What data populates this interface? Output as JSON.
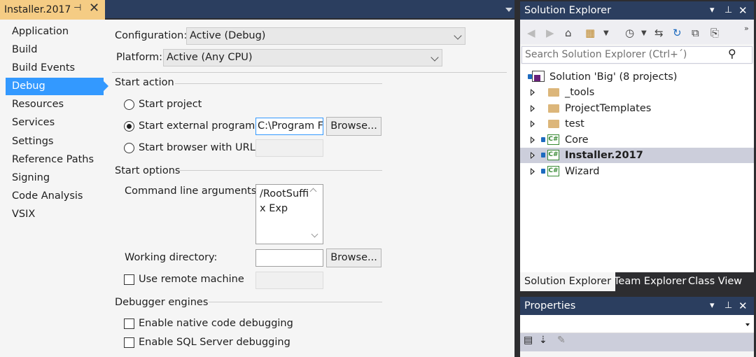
{
  "doc_tab": {
    "title": "Installer.2017",
    "pin_icon": "pin-icon",
    "close_icon": "close-icon"
  },
  "nav": {
    "items": [
      "Application",
      "Build",
      "Build Events",
      "Debug",
      "Resources",
      "Services",
      "Settings",
      "Reference Paths",
      "Signing",
      "Code Analysis",
      "VSIX"
    ],
    "active": "Debug"
  },
  "config": {
    "configuration_label": "Configuration:",
    "configuration_value": "Active (Debug)",
    "platform_label": "Platform:",
    "platform_value": "Active (Any CPU)"
  },
  "start_action": {
    "header": "Start action",
    "start_project": "Start project",
    "start_external": "Start external program:",
    "external_path": "C:\\Program Fil",
    "start_browser": "Start browser with URL:",
    "browse_label": "Browse...",
    "selected": "start_external"
  },
  "start_options": {
    "header": "Start options",
    "cmd_label": "Command line arguments:",
    "cmd_value": "/RootSuffix Exp",
    "working_dir_label": "Working directory:",
    "working_dir_value": "",
    "browse_label": "Browse...",
    "remote_label": "Use remote machine"
  },
  "debugger_engines": {
    "header": "Debugger engines",
    "native": "Enable native code debugging",
    "sql": "Enable SQL Server debugging"
  },
  "solution_explorer": {
    "title": "Solution Explorer",
    "search_placeholder": "Search Solution Explorer (Ctrl+´)",
    "tree": [
      {
        "label": "Solution 'Big' (8 projects)",
        "type": "solution"
      },
      {
        "label": "_tools",
        "type": "folder"
      },
      {
        "label": "ProjectTemplates",
        "type": "folder"
      },
      {
        "label": "test",
        "type": "folder"
      },
      {
        "label": "Core",
        "type": "csproj"
      },
      {
        "label": "Installer.2017",
        "type": "csproj",
        "selected": true
      },
      {
        "label": "Wizard",
        "type": "csproj"
      }
    ],
    "cs_badge": "C#",
    "tabs": [
      "Solution Explorer",
      "Team Explorer",
      "Class View"
    ],
    "active_tab": "Solution Explorer"
  },
  "properties": {
    "title": "Properties"
  },
  "colors": {
    "title_bar": "#2b3e5f",
    "active_tab": "#f5cc84",
    "selection": "#3399ff",
    "tree_selected": "#cccedb"
  }
}
